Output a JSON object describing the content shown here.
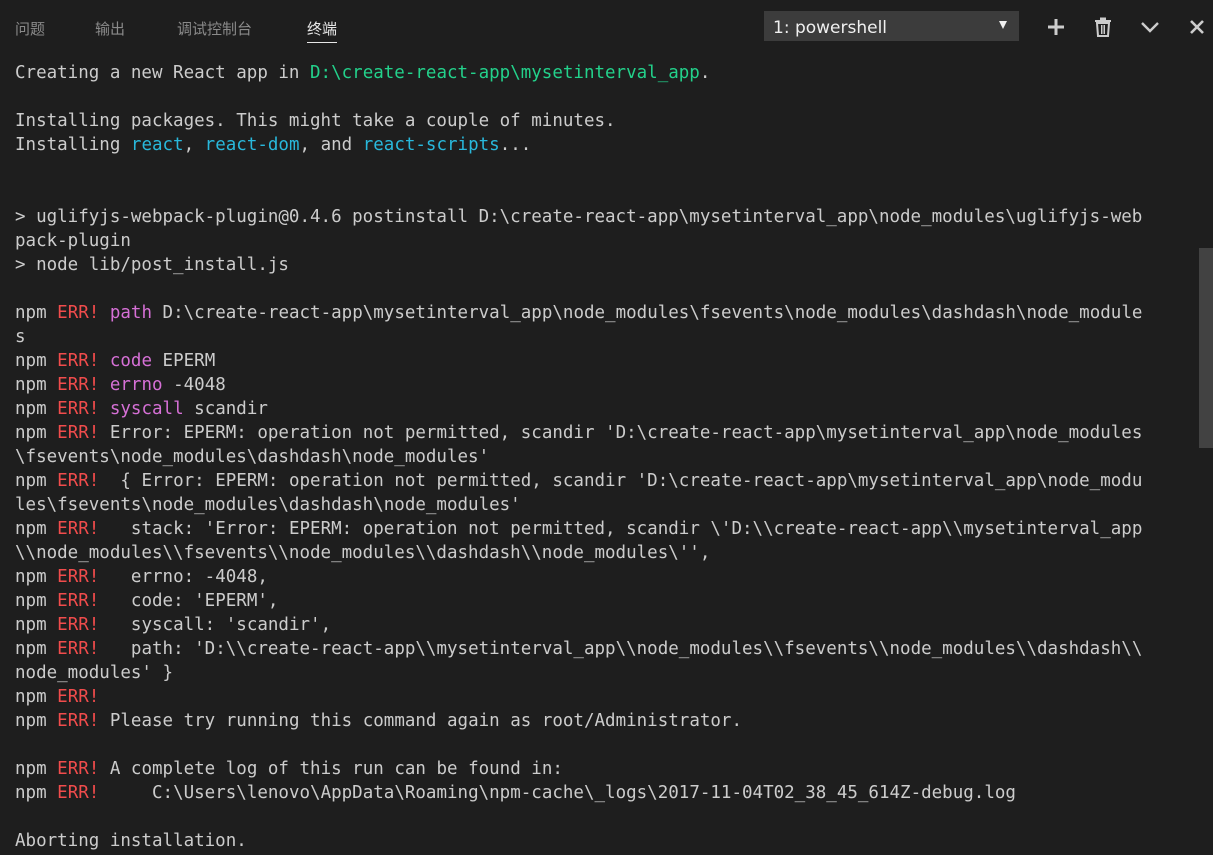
{
  "tabs": [
    {
      "label": "问题",
      "active": false
    },
    {
      "label": "输出",
      "active": false
    },
    {
      "label": "调试控制台",
      "active": false
    },
    {
      "label": "终端",
      "active": true
    }
  ],
  "terminal_select": {
    "value": "1: powershell"
  },
  "actions": [
    "add-icon",
    "trash-icon",
    "chevron-down-icon",
    "close-icon"
  ],
  "colors": {
    "green": "#23d18b",
    "blue": "#29b8db",
    "red": "#f14c4c",
    "magenta": "#d670d6",
    "text": "#cccccc",
    "background": "#1e1e1e"
  },
  "terminal_lines": [
    [
      {
        "t": "Creating a new React app in "
      },
      {
        "t": "D:\\create-react-app\\mysetinterval_app",
        "c": "green"
      },
      {
        "t": "."
      }
    ],
    [],
    [
      {
        "t": "Installing packages. This might take a couple of minutes."
      }
    ],
    [
      {
        "t": "Installing "
      },
      {
        "t": "react",
        "c": "blue"
      },
      {
        "t": ", "
      },
      {
        "t": "react-dom",
        "c": "blue"
      },
      {
        "t": ", and "
      },
      {
        "t": "react-scripts",
        "c": "blue"
      },
      {
        "t": "..."
      }
    ],
    [],
    [],
    [
      {
        "t": "> uglifyjs-webpack-plugin@0.4.6 postinstall D:\\create-react-app\\mysetinterval_app\\node_modules\\uglifyjs-web"
      }
    ],
    [
      {
        "t": "pack-plugin"
      }
    ],
    [
      {
        "t": "> node lib/post_install.js"
      }
    ],
    [],
    [
      {
        "t": "npm "
      },
      {
        "t": "ERR!",
        "c": "red"
      },
      {
        "t": " "
      },
      {
        "t": "path",
        "c": "magenta"
      },
      {
        "t": " D:\\create-react-app\\mysetinterval_app\\node_modules\\fsevents\\node_modules\\dashdash\\node_module"
      }
    ],
    [
      {
        "t": "s"
      }
    ],
    [
      {
        "t": "npm "
      },
      {
        "t": "ERR!",
        "c": "red"
      },
      {
        "t": " "
      },
      {
        "t": "code",
        "c": "magenta"
      },
      {
        "t": " EPERM"
      }
    ],
    [
      {
        "t": "npm "
      },
      {
        "t": "ERR!",
        "c": "red"
      },
      {
        "t": " "
      },
      {
        "t": "errno",
        "c": "magenta"
      },
      {
        "t": " -4048"
      }
    ],
    [
      {
        "t": "npm "
      },
      {
        "t": "ERR!",
        "c": "red"
      },
      {
        "t": " "
      },
      {
        "t": "syscall",
        "c": "magenta"
      },
      {
        "t": " scandir"
      }
    ],
    [
      {
        "t": "npm "
      },
      {
        "t": "ERR!",
        "c": "red"
      },
      {
        "t": " Error: EPERM: operation not permitted, scandir 'D:\\create-react-app\\mysetinterval_app\\node_modules"
      }
    ],
    [
      {
        "t": "\\fsevents\\node_modules\\dashdash\\node_modules'"
      }
    ],
    [
      {
        "t": "npm "
      },
      {
        "t": "ERR!",
        "c": "red"
      },
      {
        "t": "  { Error: EPERM: operation not permitted, scandir 'D:\\create-react-app\\mysetinterval_app\\node_modu"
      }
    ],
    [
      {
        "t": "les\\fsevents\\node_modules\\dashdash\\node_modules'"
      }
    ],
    [
      {
        "t": "npm "
      },
      {
        "t": "ERR!",
        "c": "red"
      },
      {
        "t": "   stack: 'Error: EPERM: operation not permitted, scandir \\'D:\\\\create-react-app\\\\mysetinterval_app"
      }
    ],
    [
      {
        "t": "\\\\node_modules\\\\fsevents\\\\node_modules\\\\dashdash\\\\node_modules\\'',"
      }
    ],
    [
      {
        "t": "npm "
      },
      {
        "t": "ERR!",
        "c": "red"
      },
      {
        "t": "   errno: -4048,"
      }
    ],
    [
      {
        "t": "npm "
      },
      {
        "t": "ERR!",
        "c": "red"
      },
      {
        "t": "   code: 'EPERM',"
      }
    ],
    [
      {
        "t": "npm "
      },
      {
        "t": "ERR!",
        "c": "red"
      },
      {
        "t": "   syscall: 'scandir',"
      }
    ],
    [
      {
        "t": "npm "
      },
      {
        "t": "ERR!",
        "c": "red"
      },
      {
        "t": "   path: 'D:\\\\create-react-app\\\\mysetinterval_app\\\\node_modules\\\\fsevents\\\\node_modules\\\\dashdash\\\\"
      }
    ],
    [
      {
        "t": "node_modules' }"
      }
    ],
    [
      {
        "t": "npm "
      },
      {
        "t": "ERR!",
        "c": "red"
      }
    ],
    [
      {
        "t": "npm "
      },
      {
        "t": "ERR!",
        "c": "red"
      },
      {
        "t": " Please try running this command again as root/Administrator."
      }
    ],
    [],
    [
      {
        "t": "npm "
      },
      {
        "t": "ERR!",
        "c": "red"
      },
      {
        "t": " A complete log of this run can be found in:"
      }
    ],
    [
      {
        "t": "npm "
      },
      {
        "t": "ERR!",
        "c": "red"
      },
      {
        "t": "     C:\\Users\\lenovo\\AppData\\Roaming\\npm-cache\\_logs\\2017-11-04T02_38_45_614Z-debug.log"
      }
    ],
    [],
    [
      {
        "t": "Aborting installation."
      }
    ]
  ]
}
